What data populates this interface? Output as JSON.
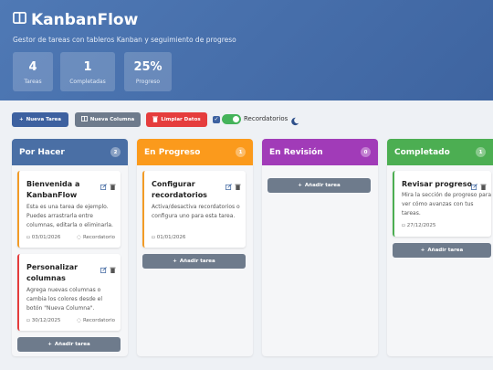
{
  "header": {
    "title": "KanbanFlow",
    "subtitle": "Gestor de tareas con tableros Kanban y seguimiento de progreso",
    "stats": [
      {
        "value": "4",
        "label": "Tareas"
      },
      {
        "value": "1",
        "label": "Completadas"
      },
      {
        "value": "25%",
        "label": "Progreso"
      }
    ]
  },
  "toolbar": {
    "add_task_label": "Nueva Tarea",
    "add_column_label": "Nueva Columna",
    "clear_label": "Limpiar Datos",
    "reminders_label": "Recordatorios",
    "reminders_checked": true
  },
  "colors": {
    "por_hacer": "#4a6fa5",
    "en_progreso": "#fb9a1c",
    "en_revision": "#a13bb8",
    "completado": "#4cae52",
    "danger": "#e53d3d"
  },
  "columns": [
    {
      "title": "Por Hacer",
      "count": "2",
      "add_label": "Añadir tarea",
      "cards": [
        {
          "title": "Bienvenida a KanbanFlow",
          "desc": "Esta es una tarea de ejemplo. Puedes arrastrarla entre columnas, editarla o eliminarla.",
          "date": "03/01/2026",
          "reminder": "Recordatorio"
        },
        {
          "title": "Personalizar columnas",
          "desc": "Agrega nuevas columnas o cambia los colores desde el botón \"Nueva Columna\".",
          "date": "30/12/2025",
          "reminder": "Recordatorio"
        }
      ]
    },
    {
      "title": "En Progreso",
      "count": "1",
      "add_label": "Añadir tarea",
      "cards": [
        {
          "title": "Configurar recordatorios",
          "desc": "Activa/desactiva recordatorios o configura uno para esta tarea.",
          "date": "01/01/2026"
        }
      ]
    },
    {
      "title": "En Revisión",
      "count": "0",
      "add_label": "Añadir tarea",
      "cards": []
    },
    {
      "title": "Completado",
      "count": "1",
      "add_label": "Añadir tarea",
      "cards": [
        {
          "title": "Revisar progreso",
          "desc": "Mira la sección de progreso para ver cómo avanzas con tus tareas.",
          "date": "27/12/2025"
        }
      ]
    }
  ]
}
